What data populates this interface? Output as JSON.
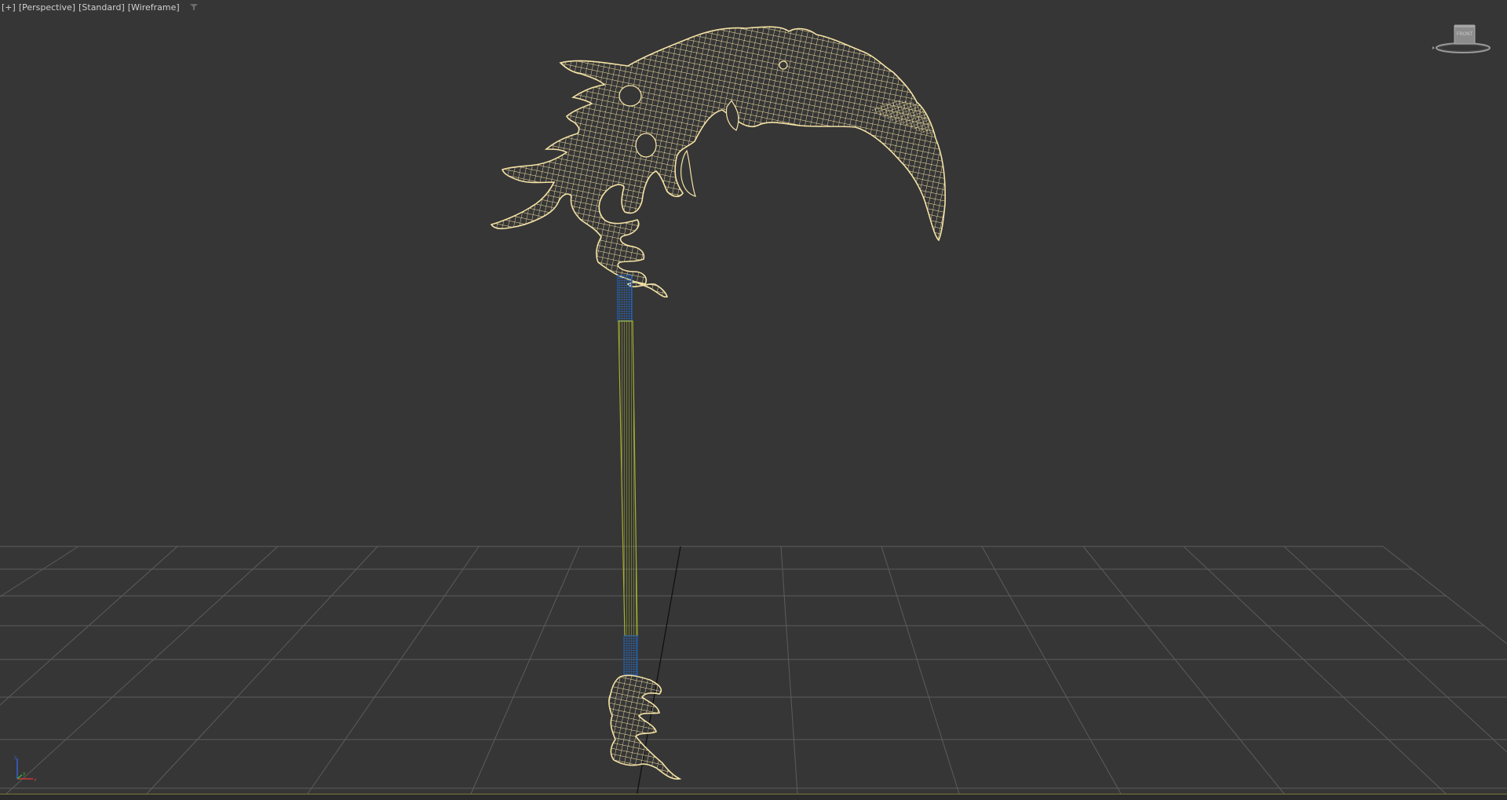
{
  "viewport": {
    "menus": [
      {
        "label": "[+]"
      },
      {
        "label": "[Perspective]"
      },
      {
        "label": "[Standard]"
      },
      {
        "label": "[Wireframe]"
      }
    ],
    "filter_icon": "filter-funnel-icon",
    "viewcube": {
      "face_label": "FRONT",
      "icon": "viewcube-icon"
    },
    "axis_tripod": {
      "axes": [
        "z",
        "x",
        "y"
      ],
      "icon": "axis-tripod-icon"
    }
  },
  "colors": {
    "background": "#363636",
    "grid": "#5c5c5c",
    "blade_wire": "#f5e3a6",
    "shaft_wire": "#a8b22a",
    "grip_wire": "#1e5fb4",
    "axis_line": "#000000",
    "label_text": "#d0d0d0"
  }
}
